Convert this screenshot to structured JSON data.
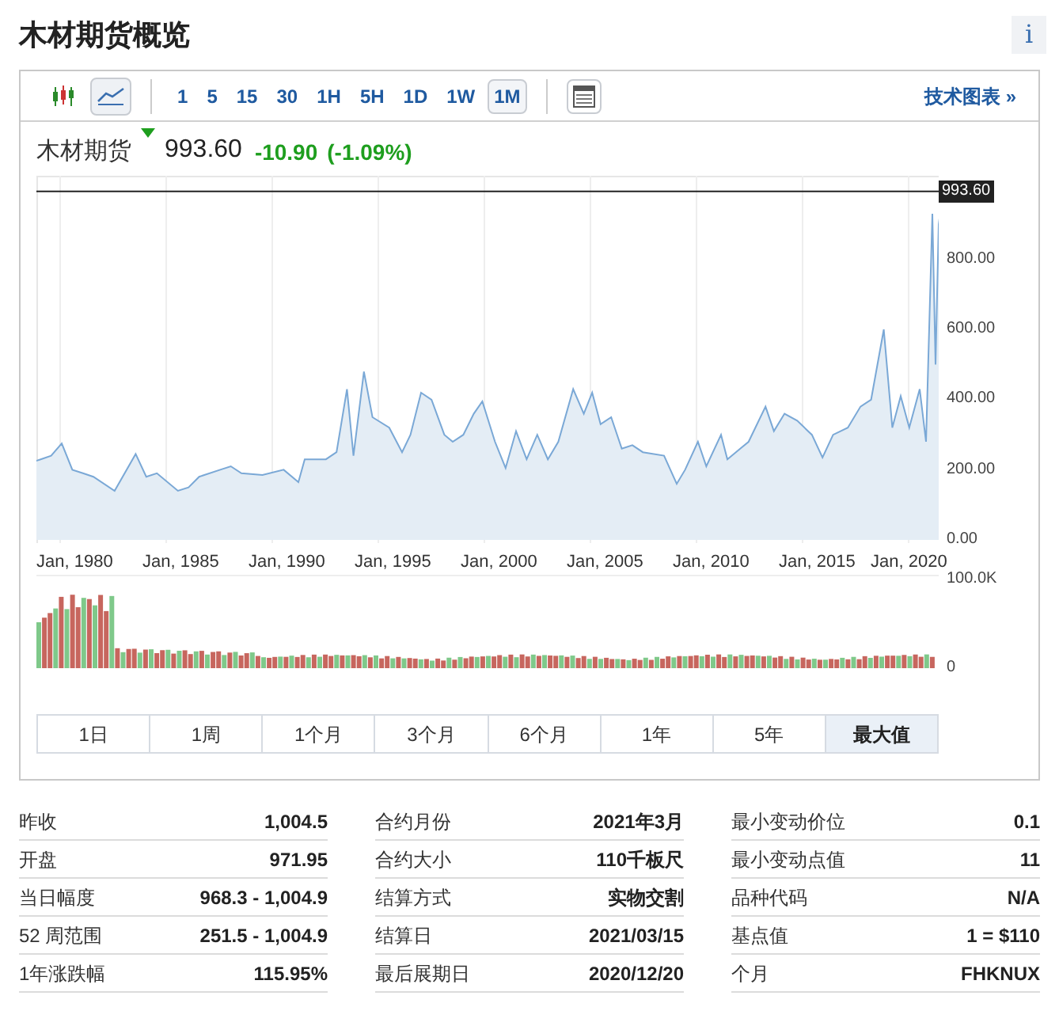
{
  "title": "木材期货概览",
  "info_button": "i",
  "toolbar": {
    "chart_types": [
      {
        "kind": "candlestick",
        "selected": false
      },
      {
        "kind": "line",
        "selected": true
      }
    ],
    "intervals": [
      {
        "label": "1",
        "selected": false
      },
      {
        "label": "5",
        "selected": false
      },
      {
        "label": "15",
        "selected": false
      },
      {
        "label": "30",
        "selected": false
      },
      {
        "label": "1H",
        "selected": false
      },
      {
        "label": "5H",
        "selected": false
      },
      {
        "label": "1D",
        "selected": false
      },
      {
        "label": "1W",
        "selected": false
      },
      {
        "label": "1M",
        "selected": true
      }
    ],
    "technical_link": "技术图表 »"
  },
  "quote": {
    "name": "木材期货",
    "down": true,
    "price": "993.60",
    "change": "-10.90",
    "change_percent": "(-1.09%)"
  },
  "price_chart": {
    "y_labels": [
      "800.00",
      "600.00",
      "400.00",
      "200.00",
      "0.00"
    ],
    "x_labels": [
      "Jan, 1980",
      "Jan, 1985",
      "Jan, 1990",
      "Jan, 1995",
      "Jan, 2000",
      "Jan, 2005",
      "Jan, 2010",
      "Jan, 2015",
      "Jan, 2020"
    ],
    "last_price_tag": "993.60"
  },
  "volume_chart": {
    "y_labels": [
      "100.0K",
      "0"
    ]
  },
  "ranges": [
    {
      "label": "1日",
      "selected": false
    },
    {
      "label": "1周",
      "selected": false
    },
    {
      "label": "1个月",
      "selected": false
    },
    {
      "label": "3个月",
      "selected": false
    },
    {
      "label": "6个月",
      "selected": false
    },
    {
      "label": "1年",
      "selected": false
    },
    {
      "label": "5年",
      "selected": false
    },
    {
      "label": "最大值",
      "selected": true
    }
  ],
  "stats": [
    [
      {
        "label": "昨收",
        "value": "1,004.5"
      },
      {
        "label": "开盘",
        "value": "971.95"
      },
      {
        "label": "当日幅度",
        "value": "968.3 - 1,004.9"
      },
      {
        "label": "52 周范围",
        "value": "251.5 - 1,004.9"
      },
      {
        "label": "1年涨跌幅",
        "value": "115.95%"
      }
    ],
    [
      {
        "label": "合约月份",
        "value": "2021年3月"
      },
      {
        "label": "合约大小",
        "value": "110千板尺"
      },
      {
        "label": "结算方式",
        "value": "实物交割"
      },
      {
        "label": "结算日",
        "value": "2021/03/15"
      },
      {
        "label": "最后展期日",
        "value": "2020/12/20"
      }
    ],
    [
      {
        "label": "最小变动价位",
        "value": "0.1"
      },
      {
        "label": "最小变动点值",
        "value": "11"
      },
      {
        "label": "品种代码",
        "value": "N/A"
      },
      {
        "label": "基点值",
        "value": "1 = $110"
      },
      {
        "label": "个月",
        "value": "FHKNUX"
      }
    ]
  ]
}
